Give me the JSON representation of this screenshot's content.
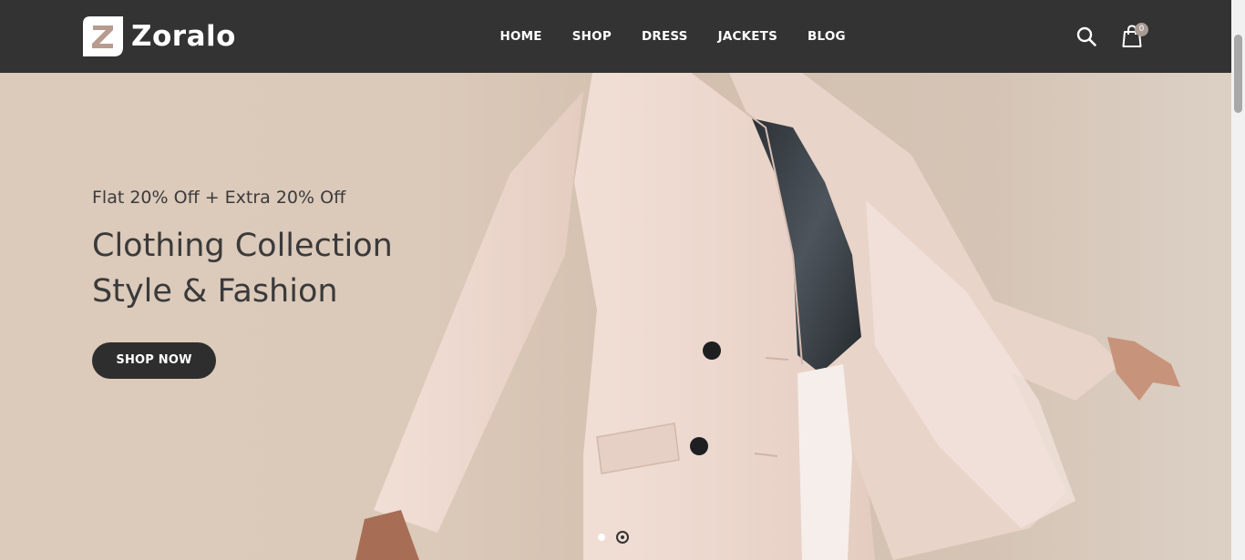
{
  "brand": {
    "name": "Zoralo",
    "logo_letter": "Z"
  },
  "nav": {
    "items": [
      {
        "label": "HOME"
      },
      {
        "label": "SHOP"
      },
      {
        "label": "DRESS"
      },
      {
        "label": "JACKETS"
      },
      {
        "label": "BLOG"
      }
    ]
  },
  "header_actions": {
    "search_icon": "search-icon",
    "cart_icon": "shopping-bag-icon",
    "cart_count": "0"
  },
  "hero": {
    "subtitle": "Flat 20% Off + Extra 20% Off",
    "title_line1": "Clothing Collection",
    "title_line2": "Style & Fashion",
    "cta_label": "SHOP NOW",
    "slide_count": 2,
    "active_slide": 2
  },
  "colors": {
    "header_bg": "#333333",
    "button_bg": "#2e2e2e",
    "hero_bg": "#d8c6b6",
    "logo_accent": "#b69b8e"
  }
}
